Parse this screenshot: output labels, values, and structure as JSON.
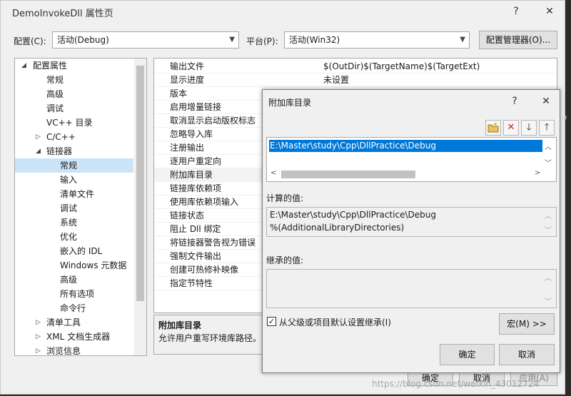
{
  "window": {
    "title": "DemoInvokeDll 属性页",
    "help": "?",
    "close": "✕"
  },
  "toolbar": {
    "config_label": "配置(C):",
    "config_value": "活动(Debug)",
    "platform_label": "平台(P):",
    "platform_value": "活动(Win32)",
    "config_manager": "配置管理器(O)..."
  },
  "tree": {
    "root": "配置属性",
    "items": [
      {
        "label": "常规"
      },
      {
        "label": "高级"
      },
      {
        "label": "调试"
      },
      {
        "label": "VC++ 目录"
      },
      {
        "label": "C/C++"
      },
      {
        "label": "链接器"
      },
      {
        "label": "常规"
      },
      {
        "label": "输入"
      },
      {
        "label": "清单文件"
      },
      {
        "label": "调试"
      },
      {
        "label": "系统"
      },
      {
        "label": "优化"
      },
      {
        "label": "嵌入的 IDL"
      },
      {
        "label": "Windows 元数据"
      },
      {
        "label": "高级"
      },
      {
        "label": "所有选项"
      },
      {
        "label": "命令行"
      },
      {
        "label": "清单工具"
      },
      {
        "label": "XML 文档生成器"
      },
      {
        "label": "浏览信息"
      }
    ]
  },
  "props": {
    "rows": [
      {
        "key": "输出文件",
        "value": "$(OutDir)$(TargetName)$(TargetExt)"
      },
      {
        "key": "显示进度",
        "value": "未设置"
      },
      {
        "key": "版本",
        "value": ""
      },
      {
        "key": "启用增量链接",
        "value": ""
      },
      {
        "key": "取消显示启动版权标志",
        "value": ""
      },
      {
        "key": "忽略导入库",
        "value": ""
      },
      {
        "key": "注册输出",
        "value": ""
      },
      {
        "key": "逐用户重定向",
        "value": ""
      },
      {
        "key": "附加库目录",
        "value": ""
      },
      {
        "key": "链接库依赖项",
        "value": ""
      },
      {
        "key": "使用库依赖项输入",
        "value": ""
      },
      {
        "key": "链接状态",
        "value": ""
      },
      {
        "key": "阻止 Dll 绑定",
        "value": ""
      },
      {
        "key": "将链接器警告视为错误",
        "value": ""
      },
      {
        "key": "强制文件输出",
        "value": ""
      },
      {
        "key": "创建可热修补映像",
        "value": ""
      },
      {
        "key": "指定节特性",
        "value": ""
      }
    ],
    "desc_title": "附加库目录",
    "desc_text": "允许用户重写环境库路径。("
  },
  "bottom_buttons": {
    "ok": "确定",
    "cancel": "取消",
    "apply": "应用(A)"
  },
  "dialog": {
    "title": "附加库目录",
    "help": "?",
    "close": "✕",
    "entry": "E:\\Master\\study\\Cpp\\DllPractice\\Debug",
    "computed_label": "计算的值:",
    "computed_lines": [
      "E:\\Master\\study\\Cpp\\DllPractice\\Debug",
      "%(AdditionalLibraryDirectories)"
    ],
    "inherited_label": "继承的值:",
    "inherit_checkbox": "从父级或项目默认设置继承(I)",
    "macro_button": "宏(M) >>",
    "ok": "确定",
    "cancel": "取消"
  },
  "watermark": "https://blog.csdn.net/weixin_43012724",
  "colors": {
    "selection": "#0078d7",
    "tree_selection": "#cce4f7",
    "delete_icon": "#c42b1c"
  }
}
